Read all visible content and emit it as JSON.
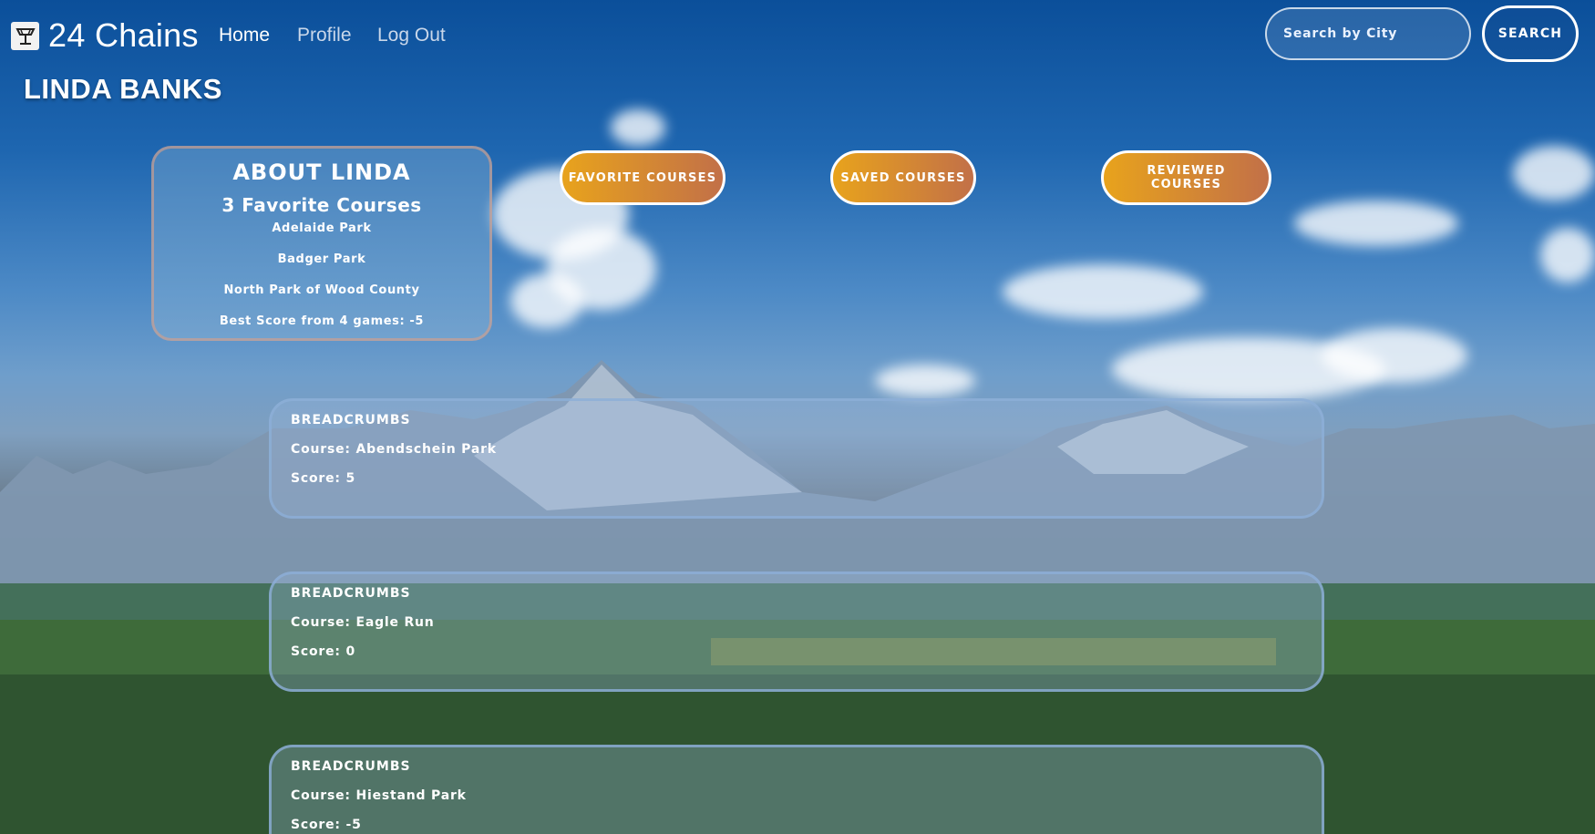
{
  "nav": {
    "brand": "24 Chains",
    "links": [
      {
        "label": "Home"
      },
      {
        "label": "Profile"
      },
      {
        "label": "Log Out"
      }
    ],
    "search": {
      "placeholder": "Search by City",
      "button_label": "SEARCH"
    }
  },
  "page_title": "LINDA BANKS",
  "about": {
    "title": "ABOUT LINDA",
    "favorite_count_label": "3 Favorite Courses",
    "items": [
      "Adelaide Park",
      "Badger Park",
      "North Park of Wood County",
      "Best Score from 4 games: -5"
    ]
  },
  "actions": [
    {
      "label": "FAVORITE COURSES"
    },
    {
      "label": "SAVED COURSES"
    },
    {
      "label": "REVIEWED COURSES"
    }
  ],
  "breadcrumbs": [
    {
      "title": "BREADCRUMBS",
      "course": "Course: Abendschein Park",
      "score": "Score: 5"
    },
    {
      "title": "BREADCRUMBS",
      "course": "Course: Eagle Run",
      "score": "Score: 0"
    },
    {
      "title": "BREADCRUMBS",
      "course": "Course: Hiestand Park",
      "score": "Score: -5"
    }
  ],
  "icons": {
    "logo": "disc-golf-basket-icon"
  },
  "colors": {
    "accent_from": "#e8a31c",
    "accent_to": "#c27048",
    "sky": "#1e66b0"
  }
}
